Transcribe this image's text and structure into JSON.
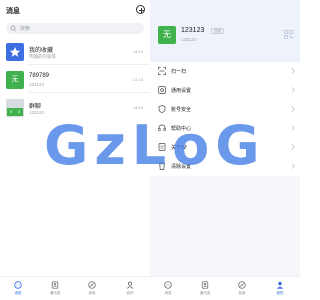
{
  "messages": {
    "title": "消息",
    "search_placeholder": "搜索",
    "chats": [
      {
        "name": "我的收藏",
        "preview": "传输的内容等",
        "time": "14:13"
      },
      {
        "name": "789789",
        "preview": "123123",
        "time": "14:13"
      },
      {
        "name": "群聊",
        "preview": "123123",
        "time": "14:16"
      }
    ],
    "group_avatar_cells": [
      "9",
      "3"
    ],
    "user_avatar_char": "无"
  },
  "tabbar_left": [
    {
      "label": "消息",
      "icon": "chat-icon",
      "active": true
    },
    {
      "label": "通讯录",
      "icon": "contacts-icon",
      "active": false
    },
    {
      "label": "探索",
      "icon": "compass-icon",
      "active": false
    },
    {
      "label": "我的",
      "icon": "person-icon",
      "active": false
    }
  ],
  "tabbar_right": [
    {
      "label": "消息",
      "icon": "chat-icon",
      "active": false
    },
    {
      "label": "通讯录",
      "icon": "contacts-icon",
      "active": false
    },
    {
      "label": "探索",
      "icon": "compass-icon",
      "active": false
    },
    {
      "label": "我的",
      "icon": "person-icon",
      "active": true
    }
  ],
  "profile": {
    "avatar_char": "无",
    "name": "123123",
    "status": "在线",
    "id": "123123"
  },
  "menu": [
    {
      "label": "扫一扫",
      "icon": "scan-icon"
    },
    {
      "label": "通用设置",
      "icon": "settings-icon"
    },
    {
      "label": "账号安全",
      "icon": "shield-icon"
    },
    {
      "label": "帮助中心",
      "icon": "headset-icon"
    },
    {
      "label": "关于IM",
      "icon": "info-icon"
    },
    {
      "label": "清除设置",
      "icon": "trash-icon"
    }
  ],
  "watermark": "GzLoG",
  "colors": {
    "accent": "#2f6ae5",
    "favorites": "#3d6fe0",
    "user_avatar": "#3fb24d",
    "watermark": "#4a82e6"
  }
}
